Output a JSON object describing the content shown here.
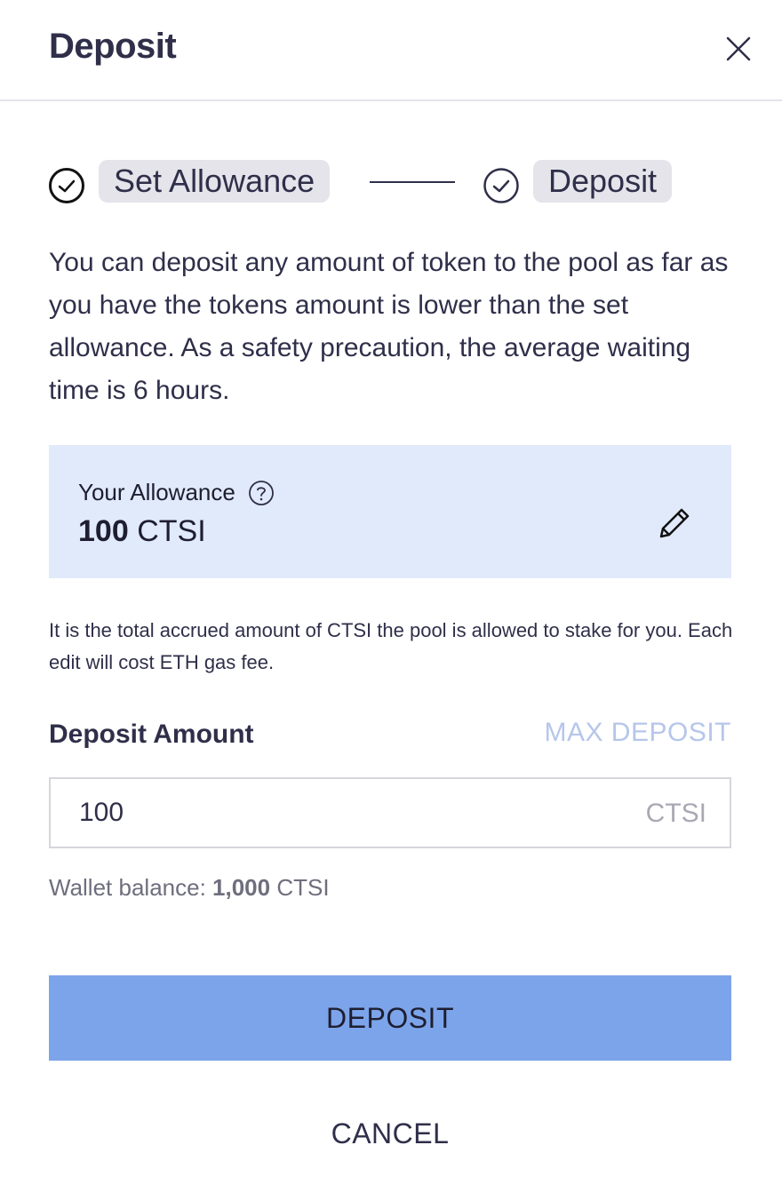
{
  "modal": {
    "title": "Deposit",
    "close_icon": "close-icon"
  },
  "steps": [
    {
      "label": "Set Allowance",
      "icon": "check-circle-icon",
      "completed": true
    },
    {
      "label": "Deposit",
      "icon": "check-circle-icon",
      "completed": false
    }
  ],
  "description": "You can deposit any amount of token to the pool as far as you have the tokens amount is lower than the set allowance. As a safety precaution, the average waiting time is 6 hours.",
  "allowance": {
    "label": "Your Allowance",
    "value": "100",
    "unit": "CTSI",
    "help_icon": "question-circle-icon",
    "edit_icon": "pencil-icon",
    "note": "It is the total accrued amount of CTSI the pool is allowed to stake for you. Each edit will cost ETH gas fee."
  },
  "deposit_amount": {
    "label": "Deposit Amount",
    "max_label": "MAX DEPOSIT",
    "value": "100",
    "unit": "CTSI"
  },
  "wallet": {
    "label": "Wallet balance:",
    "value": "1,000",
    "unit": "CTSI"
  },
  "actions": {
    "deposit_label": "DEPOSIT",
    "cancel_label": "CANCEL"
  },
  "colors": {
    "primary_text": "#2f2f4a",
    "allowance_bg": "#e1eafa",
    "deposit_button": "#7ca4ea",
    "max_deposit_text": "#b6c6ea",
    "step_label_bg": "#e4e4ea"
  }
}
